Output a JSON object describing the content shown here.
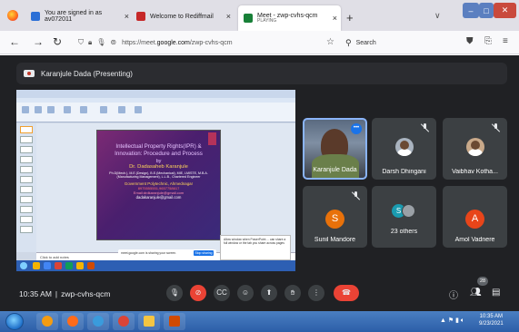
{
  "browser": {
    "tabs": [
      {
        "label": "You are signed in as av072011",
        "favicon_color": "#2b6fd6"
      },
      {
        "label": "Welcome to Rediffmail",
        "favicon_color": "#c62828"
      },
      {
        "label": "Meet - zwp-cvhs-qcm",
        "sublabel": "PLAYING",
        "favicon_color": "#188038",
        "active": true
      }
    ],
    "url_prefix": "https://meet.",
    "url_domain": "google.com",
    "url_path": "/zwp-cvhs-qcm",
    "search_placeholder": "Search",
    "new_tab_label": "+",
    "close_glyph": "×"
  },
  "meet": {
    "presenting_label": "Karanjule Dada (Presenting)",
    "time": "10:35 AM",
    "meeting_code": "zwp-cvhs-qcm",
    "participant_count": "28",
    "tiles": [
      {
        "name": "Karanjule Dada",
        "kind": "video"
      },
      {
        "name": "Darsh Dhingani",
        "kind": "photo",
        "muted": true
      },
      {
        "name": "Vaibhav Kotha...",
        "kind": "photo",
        "muted": true
      },
      {
        "name": "Sunil Mandore",
        "kind": "letter",
        "letter": "S",
        "color": "#e8710a",
        "muted": true
      },
      {
        "name": "23 others",
        "kind": "others",
        "letter": "S",
        "color": "#1a9bb0"
      },
      {
        "name": "Amol Vadnere",
        "kind": "letter",
        "letter": "A",
        "color": "#e8451a"
      }
    ]
  },
  "slide": {
    "title": "Intellectual Property Rights(IPR) & Innovation: Procedure and Process",
    "by": "by",
    "author": "Dr. Dadasaheb Karanjule",
    "qualifications": "Ph.D(Mech.), M.E.(Design), B.E.(Mechanical), MIE, LMISTE, M.B.A.(Manufacturing Management), L.L.B., Chartered Engineer",
    "institute": "Government Polytechnic, Ahmednagar",
    "phone": "8975555551,9657758617",
    "email1": "Email:drdkaranjule@gmail.com",
    "email2": "dadakaranjule@gmail.com",
    "notes_placeholder": "Click to add notes",
    "share_notice": "meet.google.com is sharing your screen.",
    "stop_label": "Stop sharing",
    "popup_text": "Allow window when PowerPoint ... can share a full window or the tab you share across pages"
  },
  "taskbar": {
    "time": "10:35 AM",
    "date": "9/23/2021"
  },
  "colors": {
    "meet_bg": "#202124",
    "tile_bg": "#3c4043",
    "end_call": "#ea4335",
    "accent": "#1a73e8"
  }
}
